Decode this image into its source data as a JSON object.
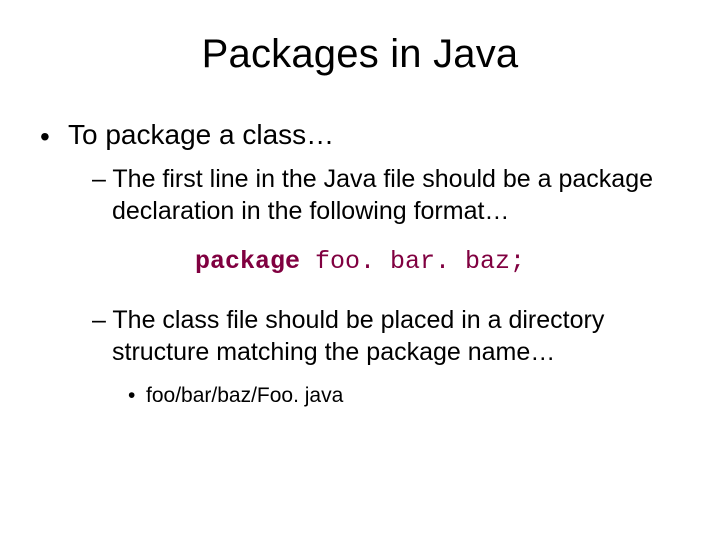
{
  "slide": {
    "title": "Packages in Java",
    "bullets": {
      "l1": "To package a class…",
      "l2a": "The first line in the Java file should be a package declaration in the following format…",
      "code_kw": "package",
      "code_rest": " foo. bar. baz;",
      "l2b": "The class file should be placed in a directory structure matching the package name…",
      "l3": "foo/bar/baz/Foo. java"
    }
  }
}
